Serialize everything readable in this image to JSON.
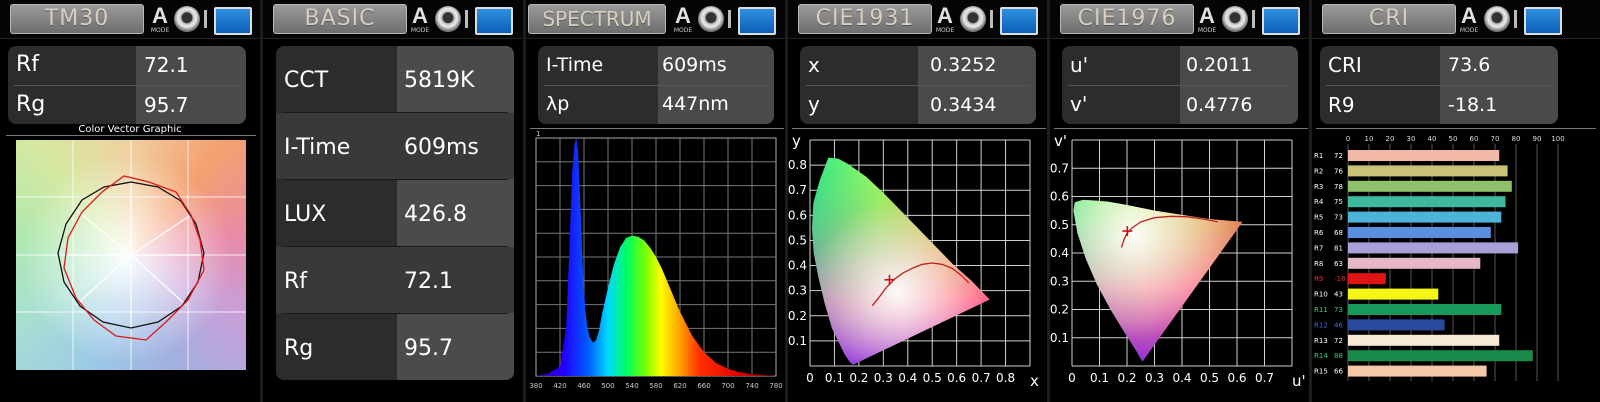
{
  "panels": {
    "tm30": {
      "title": "TM30",
      "rows": [
        {
          "label": "Rf",
          "value": "72.1"
        },
        {
          "label": "Rg",
          "value": "95.7"
        }
      ],
      "graphic_title": "Color Vector Graphic"
    },
    "basic": {
      "title": "BASIC",
      "rows": [
        {
          "label": "CCT",
          "value": "5819K"
        },
        {
          "label": "I-Time",
          "value": "609ms"
        },
        {
          "label": "LUX",
          "value": "426.8"
        },
        {
          "label": "Rf",
          "value": "72.1"
        },
        {
          "label": "Rg",
          "value": "95.7"
        }
      ]
    },
    "spectrum": {
      "title": "SPECTRUM",
      "rows": [
        {
          "label": "I-Time",
          "value": "609ms"
        },
        {
          "label": "λp",
          "value": "447nm"
        }
      ],
      "y_top_label": "1"
    },
    "cie1931": {
      "title": "CIE1931",
      "rows": [
        {
          "label": "x",
          "value": "0.3252"
        },
        {
          "label": "y",
          "value": "0.3434"
        }
      ],
      "x_axis_label": "x",
      "y_axis_label": "y"
    },
    "cie1976": {
      "title": "CIE1976",
      "rows": [
        {
          "label": "u'",
          "value": "0.2011"
        },
        {
          "label": "v'",
          "value": "0.4776"
        }
      ],
      "x_axis_label": "u'",
      "y_axis_label": "v'"
    },
    "cri": {
      "title": "CRI",
      "rows": [
        {
          "label": "CRI",
          "value": "73.6"
        },
        {
          "label": "R9",
          "value": "-18.1"
        }
      ]
    }
  },
  "mode_icon": {
    "letter": "A",
    "caption": "MODE"
  },
  "chart_data": [
    {
      "type": "line",
      "name": "spectrum",
      "x_ticks": [
        "380",
        "420",
        "460",
        "500",
        "540",
        "580",
        "620",
        "660",
        "700",
        "740",
        "780"
      ],
      "xlim": [
        380,
        780
      ],
      "ylim": [
        0,
        1
      ],
      "x": [
        380,
        400,
        420,
        430,
        436,
        440,
        444,
        447,
        450,
        454,
        458,
        462,
        466,
        470,
        475,
        480,
        485,
        490,
        500,
        510,
        520,
        530,
        540,
        550,
        560,
        570,
        580,
        590,
        600,
        620,
        640,
        660,
        680,
        700,
        720,
        740,
        760,
        780
      ],
      "y": [
        0.0,
        0.01,
        0.04,
        0.2,
        0.55,
        0.85,
        0.97,
        1.0,
        0.95,
        0.72,
        0.45,
        0.28,
        0.2,
        0.16,
        0.14,
        0.15,
        0.19,
        0.26,
        0.37,
        0.47,
        0.54,
        0.58,
        0.59,
        0.585,
        0.57,
        0.54,
        0.5,
        0.45,
        0.39,
        0.27,
        0.17,
        0.1,
        0.055,
        0.03,
        0.015,
        0.008,
        0.004,
        0.0
      ]
    },
    {
      "type": "scatter",
      "name": "cie1931",
      "x_ticks": [
        "0",
        "0.1",
        "0.2",
        "0.3",
        "0.4",
        "0.5",
        "0.6",
        "0.7",
        "0.8"
      ],
      "y_ticks": [
        "0",
        "0.1",
        "0.2",
        "0.3",
        "0.4",
        "0.5",
        "0.6",
        "0.7",
        "0.8"
      ],
      "xlim": [
        0,
        0.9
      ],
      "ylim": [
        0,
        0.9
      ],
      "point": {
        "x": 0.3252,
        "y": 0.3434
      }
    },
    {
      "type": "scatter",
      "name": "cie1976",
      "x_ticks": [
        "0",
        "0.1",
        "0.2",
        "0.3",
        "0.4",
        "0.5",
        "0.6",
        "0.7"
      ],
      "y_ticks": [
        "0",
        "0.1",
        "0.2",
        "0.3",
        "0.4",
        "0.5",
        "0.6",
        "0.7"
      ],
      "xlim": [
        0,
        0.8
      ],
      "ylim": [
        0,
        0.8
      ],
      "point": {
        "x": 0.2011,
        "y": 0.4776
      }
    },
    {
      "type": "bar",
      "name": "cri",
      "x_ticks": [
        "0",
        "10",
        "20",
        "30",
        "40",
        "50",
        "60",
        "70",
        "80",
        "90",
        "100"
      ],
      "xlim": [
        0,
        100
      ],
      "categories": [
        "R1",
        "R2",
        "R3",
        "R4",
        "R5",
        "R6",
        "R7",
        "R8",
        "R9",
        "R10",
        "R11",
        "R12",
        "R13",
        "R14",
        "R15"
      ],
      "values": [
        72,
        76,
        78,
        75,
        73,
        68,
        81,
        63,
        -18,
        43,
        73,
        46,
        72,
        88,
        66
      ],
      "colors": [
        "#f2b9a8",
        "#c9c27a",
        "#8fc06a",
        "#3fb8a0",
        "#4bb4d8",
        "#5a8fe0",
        "#a9a0d8",
        "#e6b8c6",
        "#e01414",
        "#f5f516",
        "#1a9a5a",
        "#2a4aa0",
        "#f6e9d6",
        "#1a8a4a",
        "#f4c9a8"
      ],
      "label_colors": [
        "#ffffff",
        "#ffffff",
        "#ffffff",
        "#ffffff",
        "#ffffff",
        "#ffffff",
        "#ffffff",
        "#ffffff",
        "#e03030",
        "#ffffff",
        "#3cc87a",
        "#4a6ad0",
        "#ffffff",
        "#3cc87a",
        "#ffffff"
      ]
    }
  ]
}
